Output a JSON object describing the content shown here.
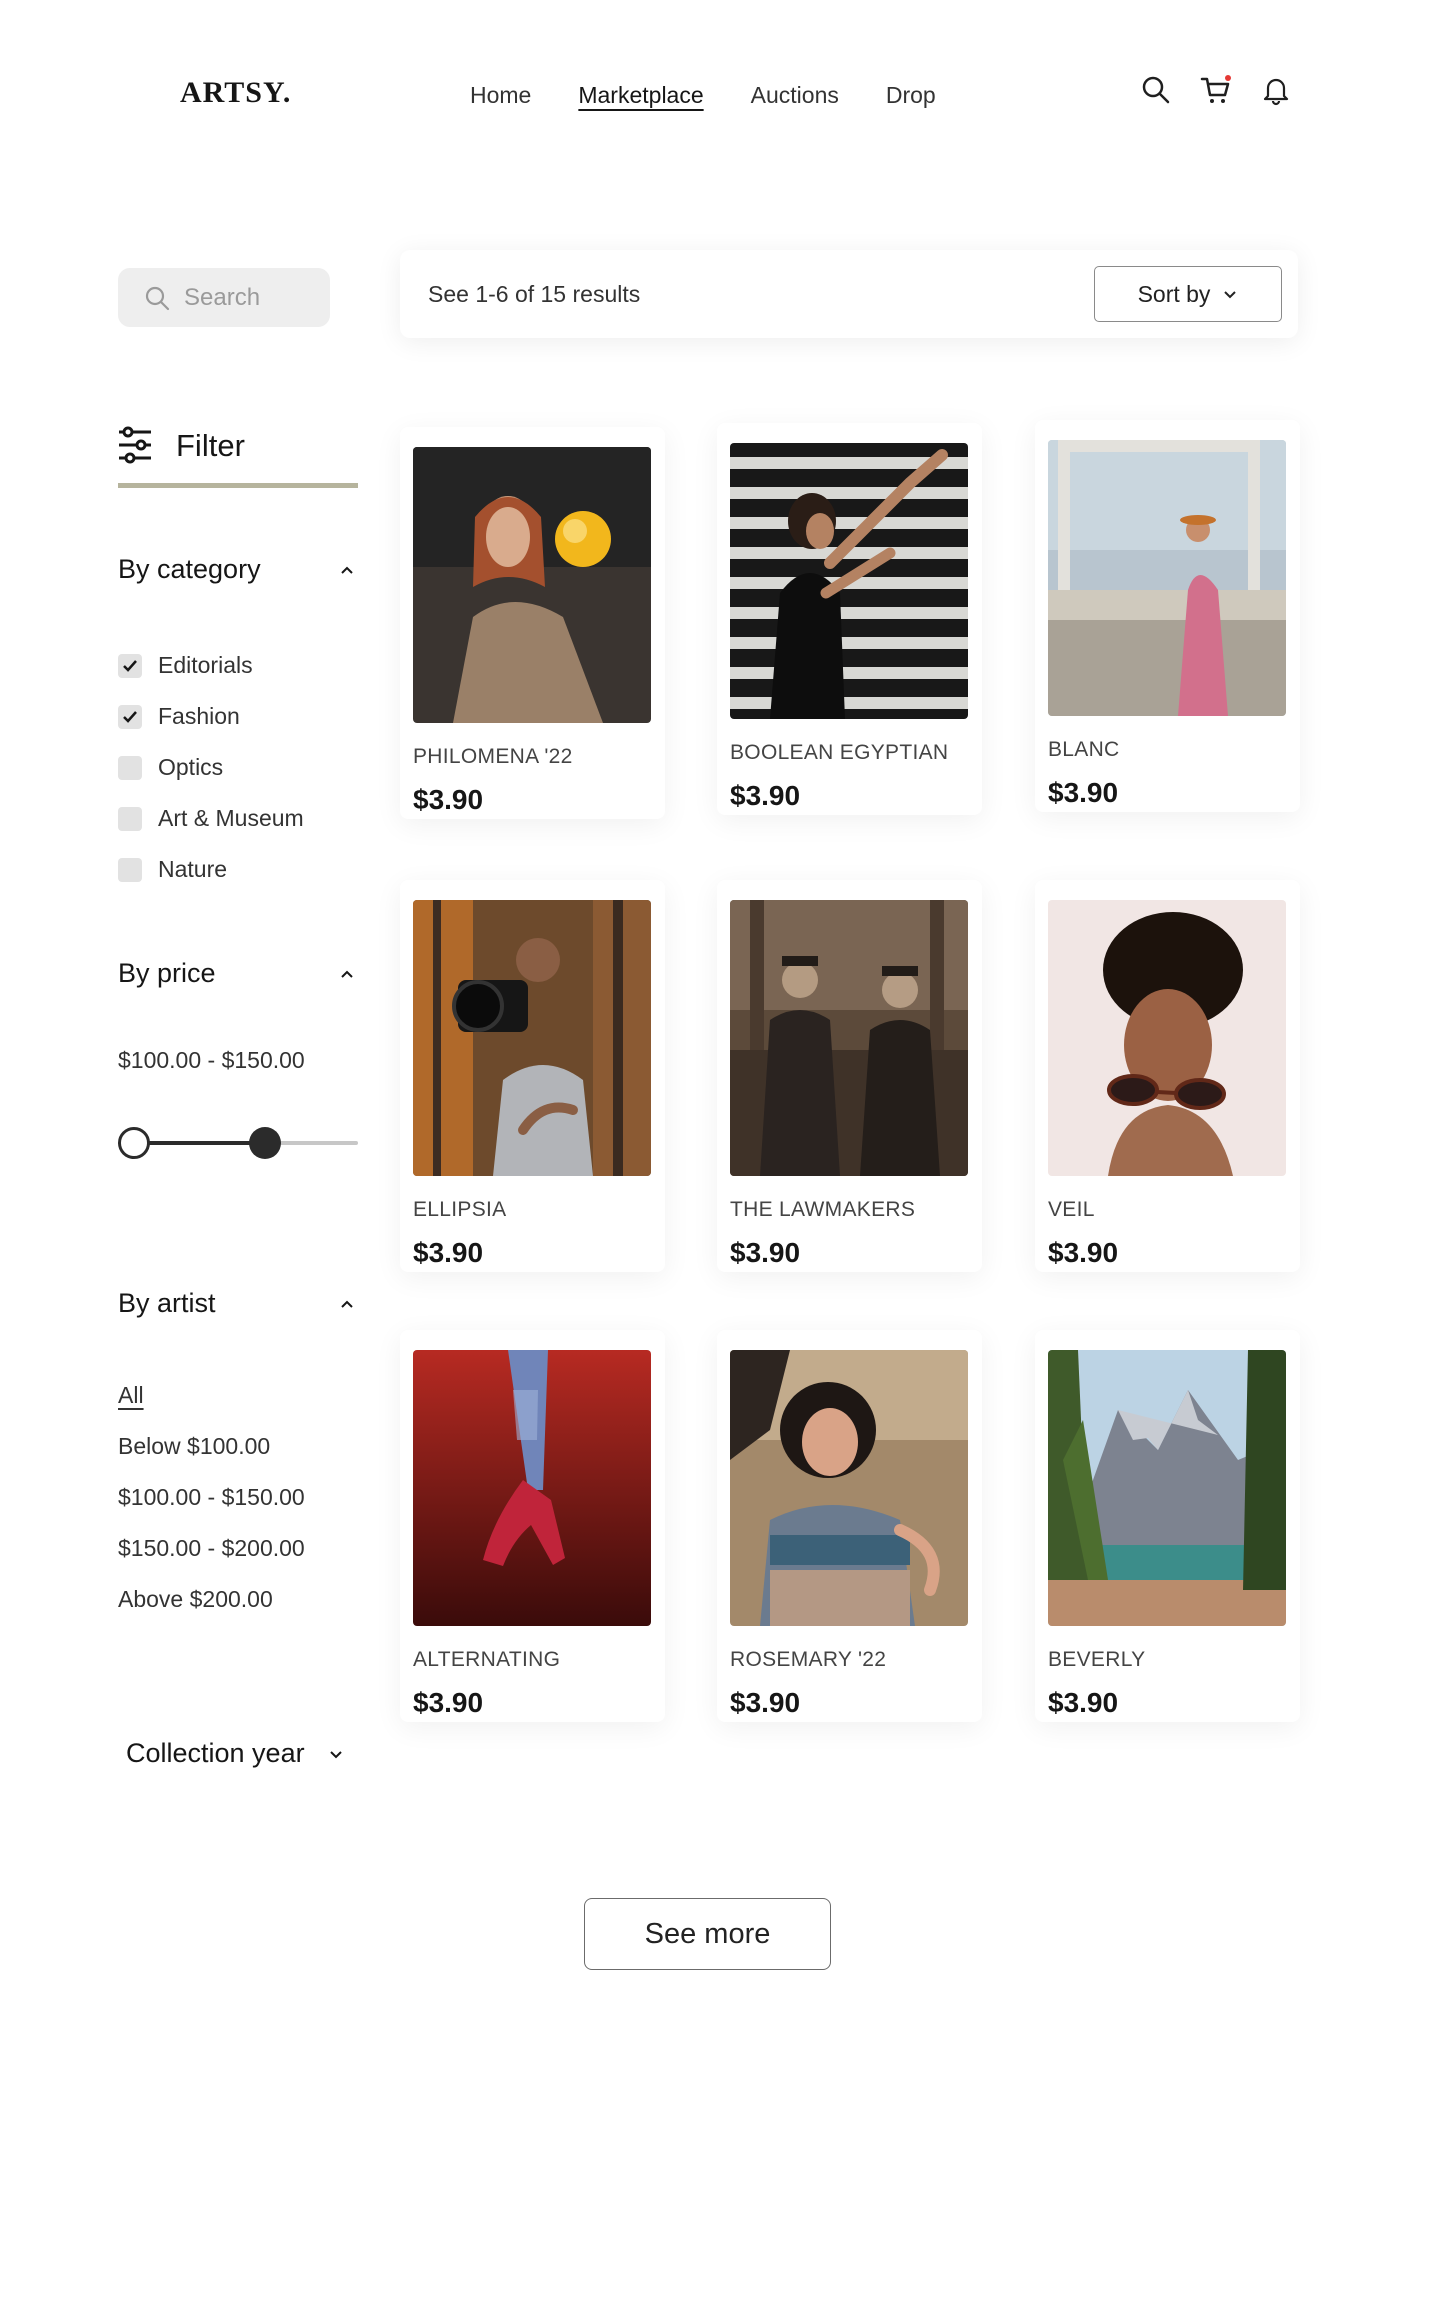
{
  "brand": {
    "logo": "ARTSY."
  },
  "nav": {
    "home": "Home",
    "marketplace": "Marketplace",
    "auctions": "Auctions",
    "drop": "Drop"
  },
  "icons": {
    "search": "search-icon",
    "cart": "cart-icon",
    "bell": "bell-icon"
  },
  "search": {
    "placeholder": "Search"
  },
  "filter": {
    "title": "Filter"
  },
  "category": {
    "title": "By category",
    "items": [
      {
        "label": "Editorials",
        "checked": true
      },
      {
        "label": "Fashion",
        "checked": true
      },
      {
        "label": "Optics",
        "checked": false
      },
      {
        "label": "Art & Museum",
        "checked": false
      },
      {
        "label": "Nature",
        "checked": false
      }
    ]
  },
  "price": {
    "title": "By price",
    "range": "$100.00 - $150.00"
  },
  "artist": {
    "title": "By artist",
    "items": [
      "All",
      "Below $100.00",
      "$100.00 - $150.00",
      "$150.00 - $200.00",
      "Above $200.00"
    ]
  },
  "collection_year": {
    "title": "Collection year"
  },
  "results": {
    "count_text": "See 1-6 of 15 results",
    "sort_label": "Sort by"
  },
  "products": [
    {
      "title": "PHILOMENA '22",
      "price": "$3.90"
    },
    {
      "title": "BOOLEAN EGYPTIAN",
      "price": "$3.90"
    },
    {
      "title": "BLANC",
      "price": "$3.90"
    },
    {
      "title": "ELLIPSIA",
      "price": "$3.90"
    },
    {
      "title": "THE LAWMAKERS",
      "price": "$3.90"
    },
    {
      "title": "VEIL",
      "price": "$3.90"
    },
    {
      "title": "ALTERNATING",
      "price": "$3.90"
    },
    {
      "title": "ROSEMARY '22",
      "price": "$3.90"
    },
    {
      "title": "BEVERLY",
      "price": "$3.90"
    }
  ],
  "see_more": "See more",
  "colors": {
    "accent_underline": "#b6b49d",
    "cart_dot": "#e53935",
    "text": "#161616"
  }
}
